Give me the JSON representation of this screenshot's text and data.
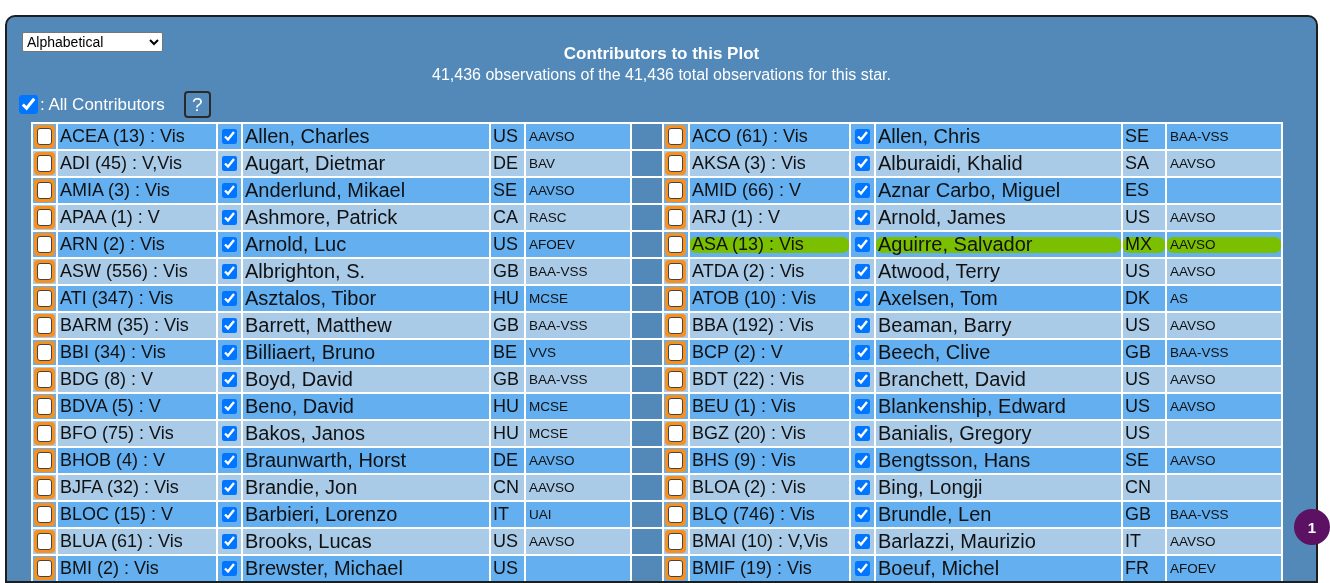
{
  "sort_select": {
    "value": "Alphabetical"
  },
  "title": "Contributors to this Plot",
  "subtitle": "41,436 observations of the 41,436 total observations for this star.",
  "all_contributors": {
    "label": ": All Contributors",
    "checked": true,
    "help_button": "?"
  },
  "table": {
    "rows": [
      {
        "left": {
          "code": "ACEA (13) : Vis",
          "marked": false,
          "included": true,
          "name": "Allen, Charles",
          "country": "US",
          "org": "AAVSO"
        },
        "right": {
          "code": "ACO (61) : Vis",
          "marked": false,
          "included": true,
          "name": "Allen, Chris",
          "country": "SE",
          "org": "BAA-VSS"
        }
      },
      {
        "left": {
          "code": "ADI (45) : V,Vis",
          "marked": false,
          "included": true,
          "name": "Augart, Dietmar",
          "country": "DE",
          "org": "BAV"
        },
        "right": {
          "code": "AKSA (3) : Vis",
          "marked": false,
          "included": true,
          "name": "Alburaidi, Khalid",
          "country": "SA",
          "org": "AAVSO"
        }
      },
      {
        "left": {
          "code": "AMIA (3) : Vis",
          "marked": false,
          "included": true,
          "name": "Anderlund, Mikael",
          "country": "SE",
          "org": "AAVSO"
        },
        "right": {
          "code": "AMID (66) : V",
          "marked": false,
          "included": true,
          "name": "Aznar Carbo, Miguel",
          "country": "ES"
        }
      },
      {
        "left": {
          "code": "APAA (1) : V",
          "marked": false,
          "included": true,
          "name": "Ashmore, Patrick",
          "country": "CA",
          "org": "RASC"
        },
        "right": {
          "code": "ARJ (1) : V",
          "marked": false,
          "included": true,
          "name": "Arnold, James",
          "country": "US",
          "org": "AAVSO"
        }
      },
      {
        "left": {
          "code": "ARN (2) : Vis",
          "marked": false,
          "included": true,
          "name": "Arnold, Luc",
          "country": "US",
          "org": "AFOEV"
        },
        "right": {
          "code": "ASA (13) : Vis",
          "marked": false,
          "included": true,
          "name": "Aguirre, Salvador",
          "country": "MX",
          "org": "AAVSO",
          "highlighted": true
        }
      },
      {
        "left": {
          "code": "ASW (556) : Vis",
          "marked": false,
          "included": true,
          "name": "Albrighton, S.",
          "country": "GB",
          "org": "BAA-VSS"
        },
        "right": {
          "code": "ATDA (2) : Vis",
          "marked": false,
          "included": true,
          "name": "Atwood, Terry",
          "country": "US",
          "org": "AAVSO"
        }
      },
      {
        "left": {
          "code": "ATI (347) : Vis",
          "marked": false,
          "included": true,
          "name": "Asztalos, Tibor",
          "country": "HU",
          "org": "MCSE"
        },
        "right": {
          "code": "ATOB (10) : Vis",
          "marked": false,
          "included": true,
          "name": "Axelsen, Tom",
          "country": "DK",
          "org": "AS"
        }
      },
      {
        "left": {
          "code": "BARM (35) : Vis",
          "marked": false,
          "included": true,
          "name": "Barrett, Matthew",
          "country": "GB",
          "org": "BAA-VSS"
        },
        "right": {
          "code": "BBA (192) : Vis",
          "marked": false,
          "included": true,
          "name": "Beaman, Barry",
          "country": "US",
          "org": "AAVSO"
        }
      },
      {
        "left": {
          "code": "BBI (34) : Vis",
          "marked": false,
          "included": true,
          "name": "Billiaert, Bruno",
          "country": "BE",
          "org": "VVS"
        },
        "right": {
          "code": "BCP (2) : V",
          "marked": false,
          "included": true,
          "name": "Beech, Clive",
          "country": "GB",
          "org": "BAA-VSS"
        }
      },
      {
        "left": {
          "code": "BDG (8) : V",
          "marked": false,
          "included": true,
          "name": "Boyd, David",
          "country": "GB",
          "org": "BAA-VSS"
        },
        "right": {
          "code": "BDT (22) : Vis",
          "marked": false,
          "included": true,
          "name": "Branchett, David",
          "country": "US",
          "org": "AAVSO"
        }
      },
      {
        "left": {
          "code": "BDVA (5) : V",
          "marked": false,
          "included": true,
          "name": "Beno, David",
          "country": "HU",
          "org": "MCSE"
        },
        "right": {
          "code": "BEU (1) : Vis",
          "marked": false,
          "included": true,
          "name": "Blankenship, Edward",
          "country": "US",
          "org": "AAVSO"
        }
      },
      {
        "left": {
          "code": "BFO (75) : Vis",
          "marked": false,
          "included": true,
          "name": "Bakos, Janos",
          "country": "HU",
          "org": "MCSE"
        },
        "right": {
          "code": "BGZ (20) : Vis",
          "marked": false,
          "included": true,
          "name": "Banialis, Gregory",
          "country": "US"
        }
      },
      {
        "left": {
          "code": "BHOB (4) : V",
          "marked": false,
          "included": true,
          "name": "Braunwarth, Horst",
          "country": "DE",
          "org": "AAVSO"
        },
        "right": {
          "code": "BHS (9) : Vis",
          "marked": false,
          "included": true,
          "name": "Bengtsson, Hans",
          "country": "SE",
          "org": "AAVSO"
        }
      },
      {
        "left": {
          "code": "BJFA (32) : Vis",
          "marked": false,
          "included": true,
          "name": "Brandie, Jon",
          "country": "CN",
          "org": "AAVSO"
        },
        "right": {
          "code": "BLOA (2) : Vis",
          "marked": false,
          "included": true,
          "name": "Bing, Longji",
          "country": "CN"
        }
      },
      {
        "left": {
          "code": "BLOC (15) : V",
          "marked": false,
          "included": true,
          "name": "Barbieri, Lorenzo",
          "country": "IT",
          "org": "UAI"
        },
        "right": {
          "code": "BLQ (746) : Vis",
          "marked": false,
          "included": true,
          "name": "Brundle, Len",
          "country": "GB",
          "org": "BAA-VSS"
        }
      },
      {
        "left": {
          "code": "BLUA (61) : Vis",
          "marked": false,
          "included": true,
          "name": "Brooks, Lucas",
          "country": "US",
          "org": "AAVSO"
        },
        "right": {
          "code": "BMAI (10) : V,Vis",
          "marked": false,
          "included": true,
          "name": "Barlazzi, Maurizio",
          "country": "IT",
          "org": "AAVSO"
        }
      },
      {
        "left": {
          "code": "BMI (2) : Vis",
          "marked": false,
          "included": true,
          "name": "Brewster, Michael",
          "country": "US"
        },
        "right": {
          "code": "BMIF (19) : Vis",
          "marked": false,
          "included": true,
          "name": "Boeuf, Michel",
          "country": "FR",
          "org": "AFOEV"
        }
      }
    ]
  },
  "notification_badge": "1"
}
